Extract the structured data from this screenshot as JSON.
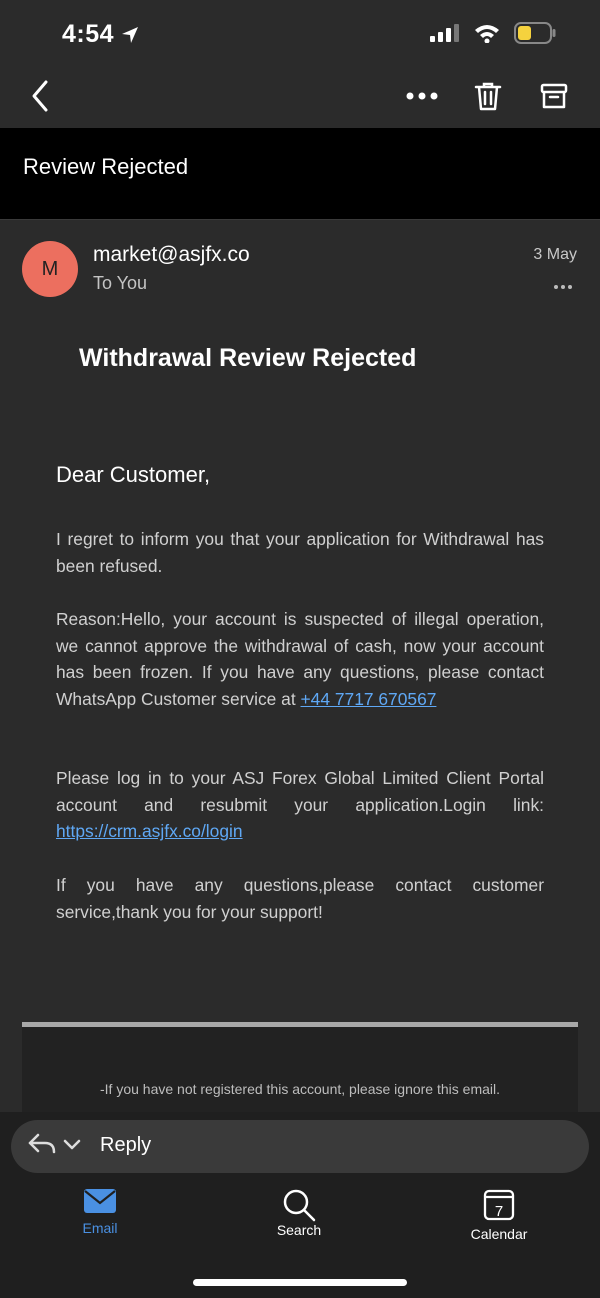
{
  "status_bar": {
    "time": "4:54"
  },
  "subject": "Review Rejected",
  "header": {
    "avatar_initial": "M",
    "sender": "market@asjfx.co",
    "to": "To You",
    "date": "3 May"
  },
  "email": {
    "title": "Withdrawal Review Rejected",
    "greeting": "Dear Customer,",
    "p1": "I regret to inform you that your application for Withdrawal has been refused.",
    "p2_text": "Reason:Hello, your account is suspected of illegal operation, we cannot approve the withdrawal of cash, now your account has been frozen. If you have any questions, please contact WhatsApp Customer service at ",
    "p2_link": "+44 7717 670567",
    "p3_text": "Please log in to your ASJ Forex Global Limited Client Portal account and resubmit your application.Login link: ",
    "p3_link": "https://crm.asjfx.co/login",
    "p4": "If you have any questions,please contact customer service,thank you for your support!",
    "footer": "-If you have not registered this account, please ignore this email."
  },
  "reply": {
    "label": "Reply"
  },
  "tabs": [
    {
      "label": "Email",
      "icon": "envelope-icon",
      "active": true
    },
    {
      "label": "Search",
      "icon": "search-icon",
      "active": false
    },
    {
      "label": "Calendar",
      "icon": "calendar-icon",
      "date": "7",
      "active": false
    }
  ],
  "colors": {
    "accent": "#4a90e2",
    "avatar": "#ec6f5f",
    "link": "#5fa8f5"
  }
}
